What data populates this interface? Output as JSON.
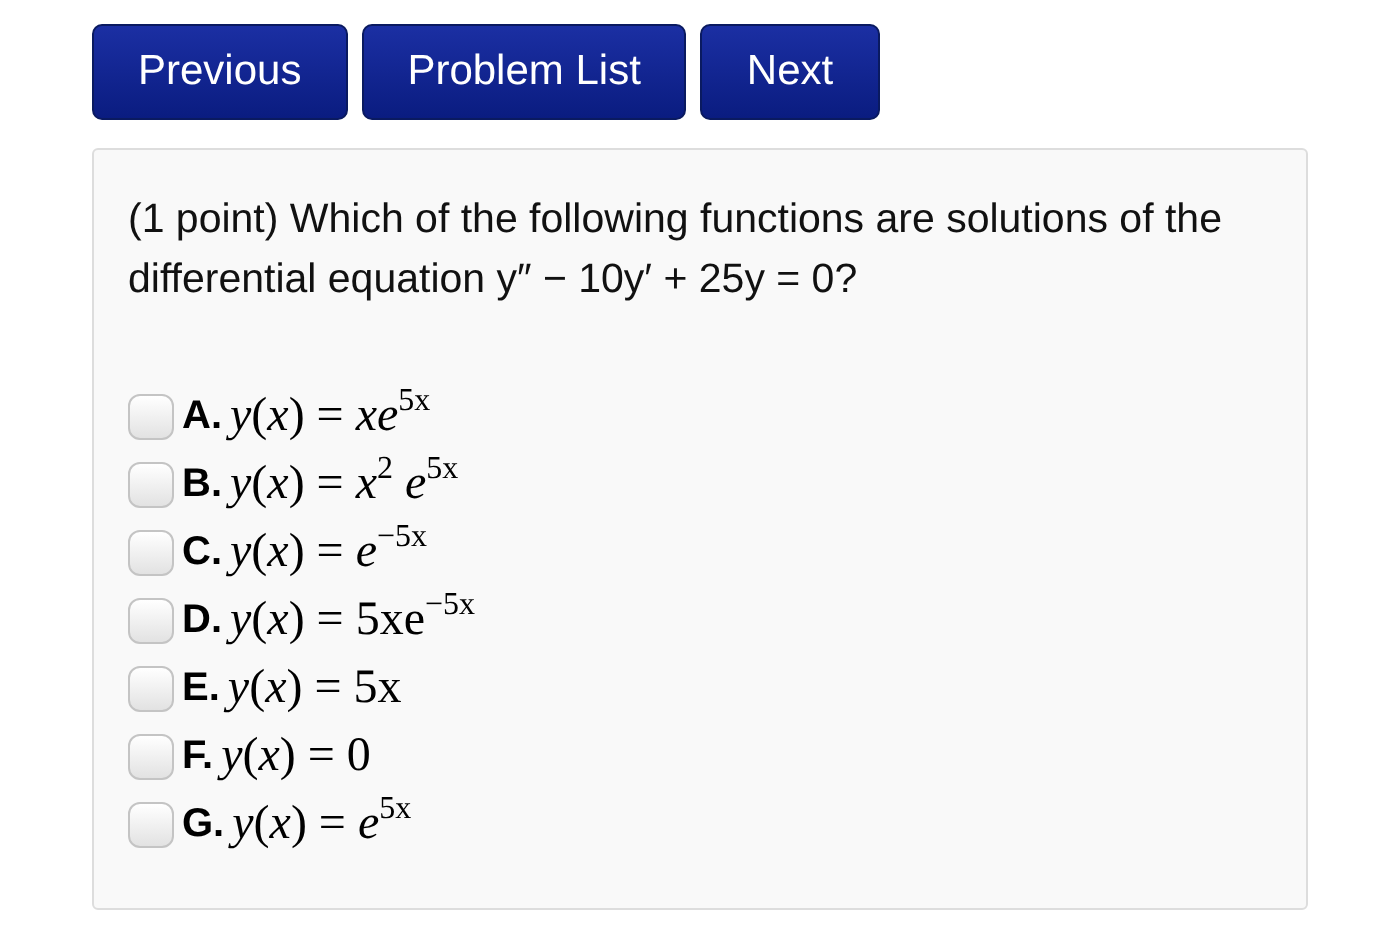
{
  "nav_buttons": [
    "Previous",
    "Problem List",
    "Next"
  ],
  "problem": {
    "question": "(1 point) Which of the following functions are solutions of the differential equation y″ − 10y′ + 25y = 0?",
    "options": [
      {
        "letter": "A.",
        "formula": "*y*(*x*) = *xe*$^{5x}$",
        "checked": false
      },
      {
        "letter": "B.",
        "formula": "*y*(*x*) = *x*$^{2}$ *e*$^{5x}$",
        "checked": false
      },
      {
        "letter": "C.",
        "formula": "*y*(*x*) = *e*$^{−5x}$",
        "checked": false
      },
      {
        "letter": "D.",
        "formula": "*y*(*x*) = 5xe$^{−5x}$",
        "checked": false
      },
      {
        "letter": "E.",
        "formula": "*y*(*x*) = 5x",
        "checked": false
      },
      {
        "letter": "F.",
        "formula": "*y*(*x*) = 0",
        "checked": false
      },
      {
        "letter": "G.",
        "formula": "*y*(*x*) = *e*$^{5x}$",
        "checked": false
      }
    ]
  }
}
